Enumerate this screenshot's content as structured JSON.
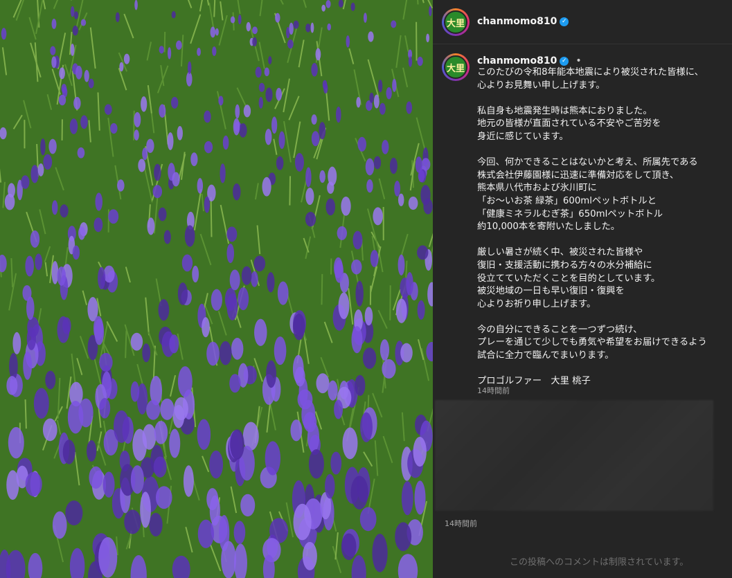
{
  "post": {
    "username": "chanmomo810",
    "avatar_text": "大里",
    "verified_symbol": "✓",
    "separator": "•",
    "caption_lines": [
      "このたびの令和8年能本地震により被災された皆様に、",
      "心よりお見舞い申し上げます。",
      "",
      "私自身も地震発生時は熊本におりました。",
      "地元の皆様が直面されている不安やご苦労を",
      "身近に感じています。",
      "",
      "今回、何かできることはないかと考え、所属先である",
      "株式会社伊藤園様に迅速に準備対応をして頂き、",
      "熊本県八代市および氷川町に",
      "「お～いお茶 緑茶」600mlペットボトルと",
      "「健康ミネラルむぎ茶」650mlペットボトル",
      "約10,000本を寄附いたしました。",
      "",
      "厳しい暑さが続く中、被災された皆様や",
      "復旧・支援活動に携わる方々の水分補給に",
      "役立てていただくことを目的としています。",
      "被災地域の一日も早い復旧・復興を",
      "心よりお祈り申し上げます。",
      "",
      "今の自分にできることを一つずつ続け、",
      "プレーを通じて少しでも勇気や希望をお届けできるよう",
      "試合に全力で臨んでまいります。",
      "",
      "プロゴルファー　大里 桃子"
    ],
    "caption_time": "14時間前",
    "post_time": "14時間前",
    "comments_restricted": "この投稿へのコメントは制限されています。"
  },
  "media": {
    "image_subject": "lavender-field-photo"
  },
  "colors": {
    "panel_bg": "#252525",
    "text_primary": "#f5f5f5",
    "text_secondary": "#a8a8a8",
    "verified_blue": "#1d9bf0",
    "lavender": "#7a4fd6",
    "foliage": "#4f8a2a"
  }
}
